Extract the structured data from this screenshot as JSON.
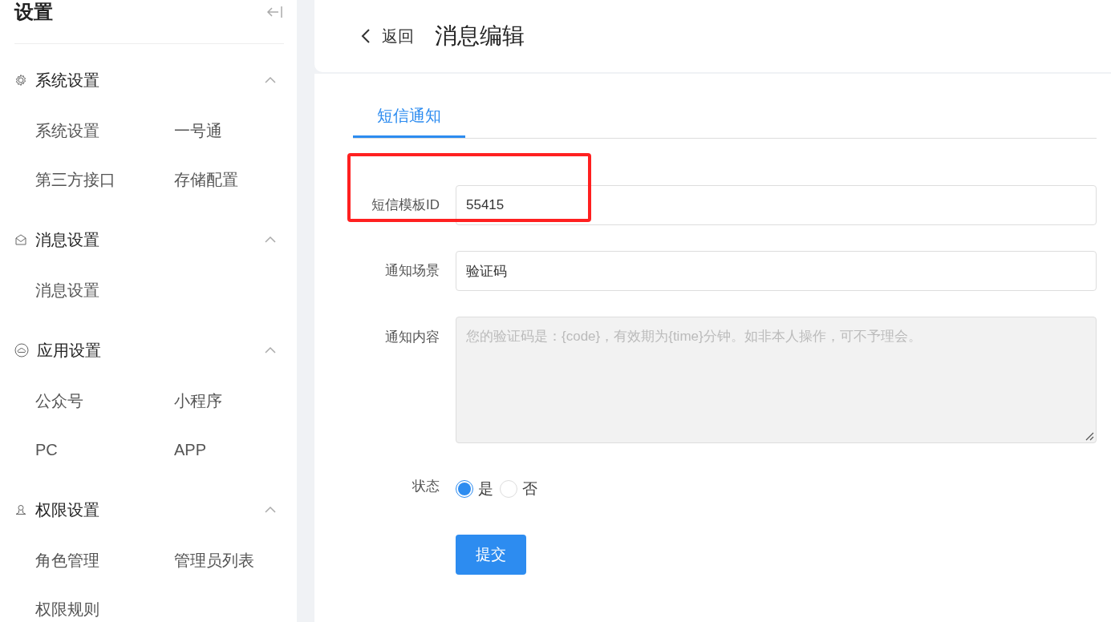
{
  "sidebar": {
    "title": "设置",
    "groups": [
      {
        "kind": "gear",
        "label": "系统设置",
        "expanded": true,
        "items": [
          "系统设置",
          "一号通",
          "第三方接口",
          "存储配置"
        ]
      },
      {
        "kind": "mail",
        "label": "消息设置",
        "expanded": true,
        "items": [
          "消息设置"
        ]
      },
      {
        "kind": "cloud",
        "label": "应用设置",
        "expanded": true,
        "items": [
          "公众号",
          "小程序",
          "PC",
          "APP"
        ]
      },
      {
        "kind": "user",
        "label": "权限设置",
        "expanded": true,
        "items": [
          "角色管理",
          "管理员列表",
          "权限规则"
        ]
      }
    ]
  },
  "header": {
    "back": "返回",
    "title": "消息编辑"
  },
  "tabs": [
    {
      "label": "短信通知",
      "selected": true
    }
  ],
  "form": {
    "fields": [
      {
        "kind": "input",
        "label": "短信模板ID",
        "value": "55415",
        "highlighted": true
      },
      {
        "kind": "input",
        "label": "通知场景",
        "value": "验证码",
        "highlighted": false
      },
      {
        "kind": "textarea",
        "label": "通知内容",
        "value": "您的验证码是：{code}，有效期为{time}分钟。如非本人操作，可不予理会。",
        "disabled": true
      },
      {
        "kind": "radio",
        "label": "状态",
        "options": [
          {
            "label": "是",
            "selected": true
          },
          {
            "label": "否",
            "selected": false
          }
        ]
      }
    ],
    "submit": "提交"
  }
}
